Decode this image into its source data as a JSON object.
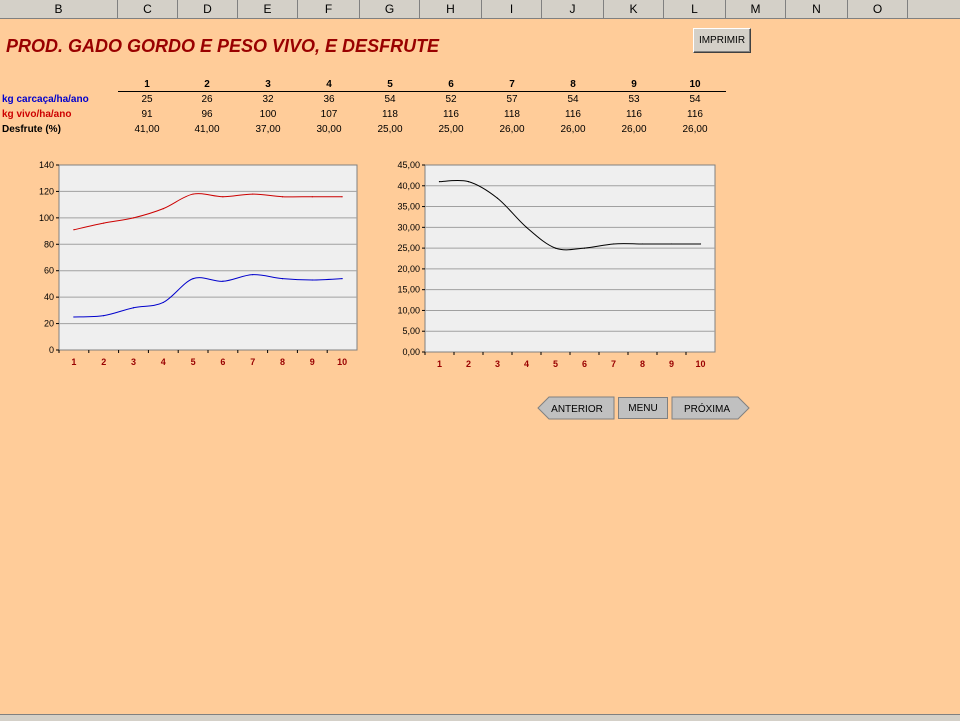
{
  "columns": [
    "B",
    "C",
    "D",
    "E",
    "F",
    "G",
    "H",
    "I",
    "J",
    "K",
    "L",
    "M",
    "N",
    "O"
  ],
  "title": "PROD. GADO GORDO E PESO VIVO, E DESFRUTE",
  "print_button": "IMPRIMIR",
  "table": {
    "headers": [
      "1",
      "2",
      "3",
      "4",
      "5",
      "6",
      "7",
      "8",
      "9",
      "10"
    ],
    "rows": [
      {
        "label": "kg carcaça/ha/ano",
        "color": "#0000cc",
        "values": [
          "25",
          "26",
          "32",
          "36",
          "54",
          "52",
          "57",
          "54",
          "53",
          "54"
        ]
      },
      {
        "label": "kg vivo/ha/ano",
        "color": "#cc0000",
        "values": [
          "91",
          "96",
          "100",
          "107",
          "118",
          "116",
          "118",
          "116",
          "116",
          "116"
        ]
      },
      {
        "label": "Desfrute (%)",
        "color": "#000000",
        "values": [
          "41,00",
          "41,00",
          "37,00",
          "30,00",
          "25,00",
          "25,00",
          "26,00",
          "26,00",
          "26,00",
          "26,00"
        ]
      }
    ]
  },
  "chart_data": [
    {
      "type": "line",
      "title": "",
      "xlabel": "",
      "ylabel": "",
      "categories": [
        "1",
        "2",
        "3",
        "4",
        "5",
        "6",
        "7",
        "8",
        "9",
        "10"
      ],
      "ylim": [
        0,
        140
      ],
      "yticks": [
        "0",
        "20",
        "40",
        "60",
        "80",
        "100",
        "120",
        "140"
      ],
      "series": [
        {
          "color": "#cc0000",
          "values": [
            91,
            96,
            100,
            107,
            118,
            116,
            118,
            116,
            116,
            116
          ]
        },
        {
          "color": "#0000cc",
          "values": [
            25,
            26,
            32,
            36,
            54,
            52,
            57,
            54,
            53,
            54
          ]
        }
      ]
    },
    {
      "type": "line",
      "title": "",
      "xlabel": "",
      "ylabel": "",
      "categories": [
        "1",
        "2",
        "3",
        "4",
        "5",
        "6",
        "7",
        "8",
        "9",
        "10"
      ],
      "ylim": [
        0,
        45
      ],
      "yticks": [
        "0,00",
        "5,00",
        "10,00",
        "15,00",
        "20,00",
        "25,00",
        "30,00",
        "35,00",
        "40,00",
        "45,00"
      ],
      "series": [
        {
          "color": "#000000",
          "values": [
            41,
            41,
            37,
            30,
            25,
            25,
            26,
            26,
            26,
            26
          ]
        }
      ]
    }
  ],
  "nav": {
    "previous": "ANTERIOR",
    "menu": "MENU",
    "next": "PRÓXIMA"
  }
}
